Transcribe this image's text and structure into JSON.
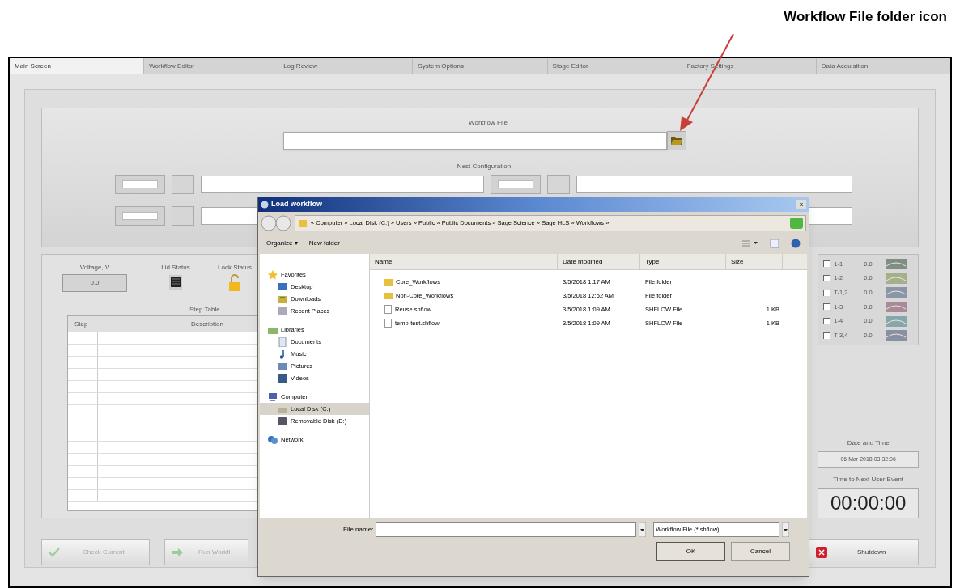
{
  "annotation": {
    "text": "Workflow File folder icon"
  },
  "tabs": [
    {
      "label": "Main Screen",
      "selected": true
    },
    {
      "label": "Workflow Editor",
      "selected": false
    },
    {
      "label": "Log Review",
      "selected": false
    },
    {
      "label": "System Options",
      "selected": false
    },
    {
      "label": "Stage Editor",
      "selected": false
    },
    {
      "label": "Factory Settings",
      "selected": false
    },
    {
      "label": "Data Acquisition",
      "selected": false
    }
  ],
  "workflow_file": {
    "label": "Workflow File"
  },
  "nest_configuration": {
    "label": "Nest Configuration"
  },
  "status": {
    "voltage_label": "Voltage, V",
    "voltage_value": "0.0",
    "lid_label": "Lid Status",
    "lock_label": "Lock Status"
  },
  "step_table": {
    "title": "Step Table",
    "columns": [
      "Step",
      "Description"
    ]
  },
  "channels": [
    {
      "label": "1-1",
      "value": "0.0",
      "checked": false,
      "color": "#7f8f86"
    },
    {
      "label": "1-2",
      "value": "0.0",
      "checked": false,
      "color": "#a4b08a"
    },
    {
      "label": "T-1,2",
      "value": "0.0",
      "checked": false,
      "color": "#8a96a8"
    },
    {
      "label": "1-3",
      "value": "0.0",
      "checked": false,
      "color": "#a88a98"
    },
    {
      "label": "1-4",
      "value": "0.0",
      "checked": false,
      "color": "#86a6ac"
    },
    {
      "label": "T-3,4",
      "value": "0.0",
      "checked": false,
      "color": "#8a90a4"
    }
  ],
  "date_time": {
    "label": "Date and Time",
    "value": "06 Mar 2018  03:32:06"
  },
  "next_event": {
    "label": "Time to Next User Event",
    "value": "00:00:00"
  },
  "buttons": [
    {
      "label": "Check Current",
      "disabled": true
    },
    {
      "label": "Run Workfl",
      "disabled": true
    },
    {
      "label": "Shutdown",
      "disabled": false
    }
  ],
  "dialog": {
    "title": "Load workflow",
    "close": "x",
    "breadcrumb": "« Computer » Local Disk (C:) » Users » Public » Public Documents » Sage Science » Sage HLS » Workflows »",
    "toolbar": [
      "Organize ▾",
      "New folder"
    ],
    "nav": [
      {
        "label": "Favorites",
        "kind": "star",
        "children": [
          {
            "label": "Desktop",
            "kind": "desktop",
            "selected": false
          },
          {
            "label": "Downloads",
            "kind": "downloads",
            "selected": false
          },
          {
            "label": "Recent Places",
            "kind": "recent",
            "selected": false
          }
        ]
      },
      {
        "label": "Libraries",
        "kind": "library",
        "children": [
          {
            "label": "Documents",
            "kind": "document",
            "selected": false
          },
          {
            "label": "Music",
            "kind": "music",
            "selected": false
          },
          {
            "label": "Pictures",
            "kind": "pictures",
            "selected": false
          },
          {
            "label": "Videos",
            "kind": "videos",
            "selected": false
          }
        ]
      },
      {
        "label": "Computer",
        "kind": "computer",
        "children": [
          {
            "label": "Local Disk (C:)",
            "kind": "disk",
            "selected": true
          },
          {
            "label": "Removable Disk (D:)",
            "kind": "removable",
            "selected": false
          }
        ]
      },
      {
        "label": "Network",
        "kind": "network"
      }
    ],
    "columns": [
      "Name",
      "Date modified",
      "Type",
      "Size"
    ],
    "files": [
      {
        "kind": "folder",
        "name": "Core_Workflows",
        "date": "3/5/2018 1:17 AM",
        "type": "File folder"
      },
      {
        "kind": "folder",
        "name": "Non-Core_Workflows",
        "date": "3/5/2018 12:52 AM",
        "type": "File folder"
      },
      {
        "kind": "file",
        "name": "Reuse.shflow",
        "date": "3/5/2018 1:09 AM",
        "type": "SHFLOW File",
        "size": "1 KB"
      },
      {
        "kind": "file",
        "name": "temp-test.shflow",
        "date": "3/5/2018 1:09 AM",
        "type": "SHFLOW File",
        "size": "1 KB"
      }
    ],
    "file_name_label": "File name:",
    "filter": "Workflow File (*.shflow)",
    "ok": "OK",
    "cancel": "Cancel"
  }
}
